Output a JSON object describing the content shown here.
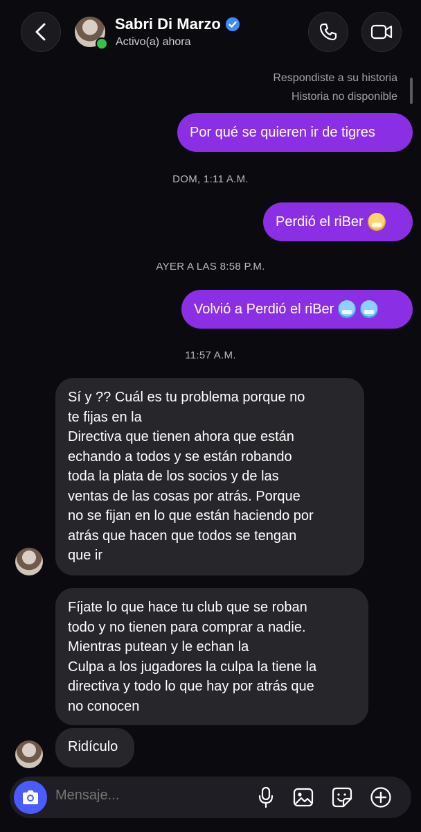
{
  "header": {
    "contact_name": "Sabri Di Marzo",
    "status": "Activo(a) ahora",
    "icons": [
      "back-arrow-icon",
      "verified-badge-icon",
      "phone-icon",
      "video-camera-icon"
    ]
  },
  "story_reply": {
    "note": "Respondiste a su historia",
    "unavailable": "Historia no disponible"
  },
  "messages": [
    {
      "from": "me",
      "text": "Por qué se quieren ir de tigres"
    },
    {
      "type": "timestamp",
      "text": "DOM, 1:11 A.M."
    },
    {
      "from": "me",
      "text": "Perdió el riBer",
      "emoji": "crying-laughing-cat"
    },
    {
      "type": "timestamp",
      "text": "AYER A LAS 8:58 P.M."
    },
    {
      "from": "me",
      "text": "Volvió a Perdió el riBer",
      "emoji": "cold-face x2"
    },
    {
      "type": "timestamp",
      "text": "11:57 A.M."
    },
    {
      "from": "them",
      "lines": [
        "Sí y ?? Cuál es tu problema porque no",
        "te fijas en la",
        "Directiva  que tienen ahora que están",
        "echando a todos y se están robando",
        "toda la plata de los socios y de las",
        "ventas de las cosas por atrás. Porque",
        "no se fijan en lo que están haciendo por",
        "atrás que hacen que todos se tengan",
        "que ir"
      ]
    },
    {
      "from": "them",
      "lines": [
        "Fíjate lo que hace tu club que se roban",
        "todo y no tienen para comprar a nadie.",
        "Mientras putean y le echan la",
        "Culpa a los jugadores la culpa la tiene la",
        "directiva y todo lo que hay por atrás que",
        "no conocen"
      ]
    },
    {
      "from": "them",
      "text": "Ridículo"
    }
  ],
  "composer": {
    "placeholder": "Mensaje...",
    "icons": [
      "camera-icon",
      "microphone-icon",
      "image-icon",
      "sticker-icon",
      "plus-icon"
    ]
  },
  "colors": {
    "outgoing_bubble": "#8a2fe3",
    "incoming_bubble": "#26262b",
    "background": "#0b0b0f",
    "camera_button": "#4a5cff",
    "online_dot": "#35c24a",
    "verified_badge": "#3d8bff"
  }
}
